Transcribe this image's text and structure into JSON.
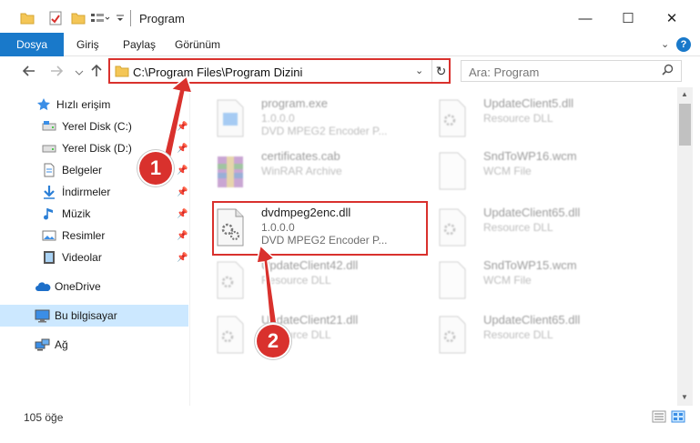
{
  "window": {
    "title": "Program",
    "minimize_glyph": "—",
    "maximize_glyph": "☐",
    "close_glyph": "✕"
  },
  "ribbon": {
    "tabs": [
      {
        "label": "Dosya"
      },
      {
        "label": "Giriş"
      },
      {
        "label": "Paylaş"
      },
      {
        "label": "Görünüm"
      }
    ],
    "help_glyph": "?"
  },
  "nav": {
    "address": "C:\\Program Files\\Program Dizini",
    "search_placeholder": "Ara: Program"
  },
  "sidebar": {
    "items": [
      {
        "label": "Hızlı erişim",
        "icon": "star-icon"
      },
      {
        "label": "Yerel Disk (C:)",
        "icon": "drive-icon",
        "pinned": true
      },
      {
        "label": "Yerel Disk (D:)",
        "icon": "drive-icon",
        "pinned": true
      },
      {
        "label": "Belgeler",
        "icon": "document-icon",
        "pinned": true
      },
      {
        "label": "İndirmeler",
        "icon": "download-icon",
        "pinned": true
      },
      {
        "label": "Müzik",
        "icon": "music-icon",
        "pinned": true
      },
      {
        "label": "Resimler",
        "icon": "pictures-icon",
        "pinned": true
      },
      {
        "label": "Videolar",
        "icon": "video-icon",
        "pinned": true
      },
      {
        "label": "OneDrive",
        "icon": "cloud-icon"
      },
      {
        "label": "Bu bilgisayar",
        "icon": "computer-icon",
        "selected": true
      },
      {
        "label": "Ağ",
        "icon": "network-icon"
      }
    ]
  },
  "files": [
    {
      "name": "program.exe",
      "line1": "1.0.0.0",
      "line2": "DVD MPEG2 Encoder P...",
      "icon": "exe-icon"
    },
    {
      "name": "certificates.cab",
      "line1": "WinRAR Archive",
      "line2": "",
      "icon": "archive-icon"
    },
    {
      "name": "dvdmpeg2enc.dll",
      "line1": "1.0.0.0",
      "line2": "DVD MPEG2 Encoder P...",
      "icon": "dll-icon"
    },
    {
      "name": "UpdateClient42.dll",
      "line1": "Resource DLL",
      "line2": "",
      "icon": "dll-icon"
    },
    {
      "name": "UpdateClient21.dll",
      "line1": "Resource DLL",
      "line2": "",
      "icon": "dll-icon"
    },
    {
      "name": "UpdateClient5.dll",
      "line1": "Resource DLL",
      "line2": "",
      "icon": "dll-icon"
    },
    {
      "name": "SndToWP16.wcm",
      "line1": "WCM File",
      "line2": "",
      "icon": "file-icon"
    },
    {
      "name": "UpdateClient65.dll",
      "line1": "Resource DLL",
      "line2": "",
      "icon": "dll-icon"
    },
    {
      "name": "SndToWP15.wcm",
      "line1": "WCM File",
      "line2": "",
      "icon": "file-icon"
    },
    {
      "name": "UpdateClient65.dll",
      "line1": "Resource DLL",
      "line2": "",
      "icon": "dll-icon"
    }
  ],
  "status": {
    "count": "105 öğe"
  },
  "annotations": {
    "callout_1": "1",
    "callout_2": "2",
    "color": "#d9312d"
  },
  "colors": {
    "accent": "#1979ca",
    "selection": "#cce8ff"
  }
}
